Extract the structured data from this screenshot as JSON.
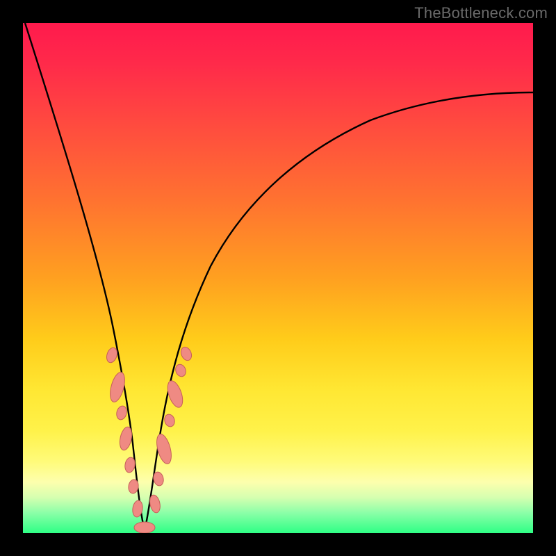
{
  "watermark": "TheBottleneck.com",
  "colors": {
    "background": "#000000",
    "gradient_top": "#ff1a4d",
    "gradient_bottom": "#2eff85",
    "curve": "#000000",
    "marker_fill": "#ef8a83",
    "marker_stroke": "#c56058"
  },
  "chart_data": {
    "type": "line",
    "title": "",
    "xlabel": "",
    "ylabel": "",
    "xlim": [
      0,
      100
    ],
    "ylim": [
      0,
      100
    ],
    "grid": false,
    "legend": null,
    "note": "Background gradient encodes a secondary scale from red (100, top) to green (0, bottom); the black curve reaches its minimum (≈0) near x≈23 and rises to ≈100 at x=0 and ≈76 at x=100.",
    "series": [
      {
        "name": "curve",
        "x": [
          0,
          5,
          8,
          11,
          14,
          17,
          18.5,
          20,
          21.5,
          23,
          24.5,
          26,
          28,
          31,
          35,
          40,
          46,
          53,
          61,
          70,
          80,
          90,
          100
        ],
        "y": [
          100,
          84,
          74,
          63,
          50,
          34,
          24,
          14,
          5,
          0,
          5,
          14,
          24,
          36,
          46,
          54,
          61,
          66,
          70,
          73,
          75,
          76,
          76
        ]
      }
    ],
    "markers": {
      "name": "highlighted-points",
      "shape": "rounded-pill",
      "x": [
        17.0,
        18.3,
        18.8,
        19.6,
        20.3,
        20.9,
        21.8,
        22.6,
        23.8,
        25.4,
        26.0,
        26.8,
        27.6,
        28.5,
        29.2,
        30.1
      ],
      "y": [
        35.0,
        28.0,
        24.0,
        18.0,
        12.5,
        8.0,
        4.0,
        1.0,
        1.0,
        6.0,
        10.5,
        16.0,
        21.0,
        26.0,
        29.5,
        34.0
      ]
    }
  }
}
